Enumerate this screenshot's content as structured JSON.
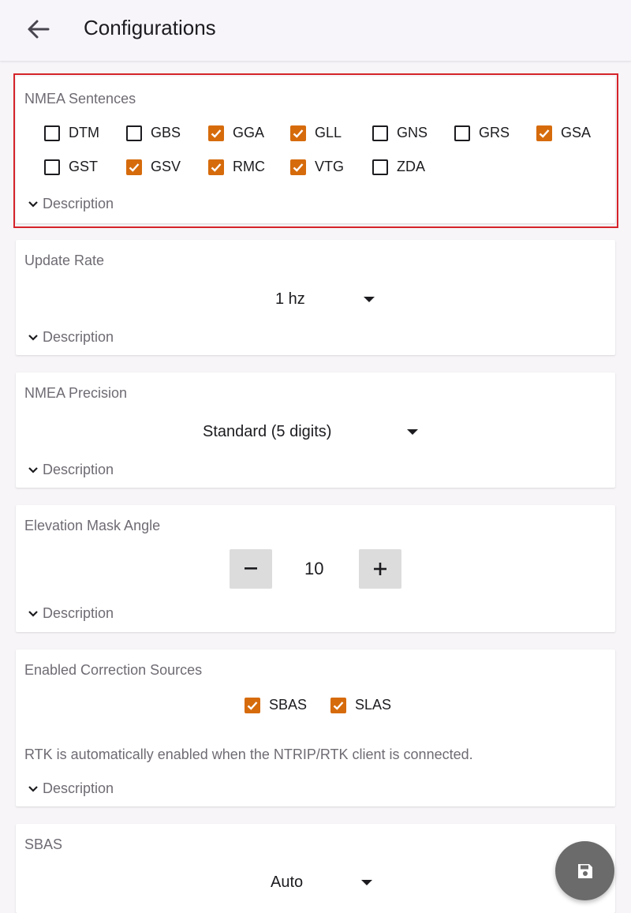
{
  "appbar": {
    "title": "Configurations"
  },
  "colors": {
    "accent": "#d66b0c",
    "highlight_border": "#d6232a",
    "fab": "#6b6b6b"
  },
  "nmea_sentences": {
    "title": "NMEA Sentences",
    "items": [
      {
        "label": "DTM",
        "checked": false
      },
      {
        "label": "GBS",
        "checked": false
      },
      {
        "label": "GGA",
        "checked": true
      },
      {
        "label": "GLL",
        "checked": true
      },
      {
        "label": "GNS",
        "checked": false
      },
      {
        "label": "GRS",
        "checked": false
      },
      {
        "label": "GSA",
        "checked": true
      },
      {
        "label": "GST",
        "checked": false
      },
      {
        "label": "GSV",
        "checked": true
      },
      {
        "label": "RMC",
        "checked": true
      },
      {
        "label": "VTG",
        "checked": true
      },
      {
        "label": "ZDA",
        "checked": false
      }
    ],
    "description": "Description"
  },
  "update_rate": {
    "title": "Update Rate",
    "value": "1 hz",
    "description": "Description"
  },
  "nmea_precision": {
    "title": "NMEA Precision",
    "value": "Standard (5 digits)",
    "description": "Description"
  },
  "elevation_mask": {
    "title": "Elevation Mask Angle",
    "value": "10",
    "minus": "−",
    "plus": "+",
    "description": "Description"
  },
  "correction_sources": {
    "title": "Enabled Correction Sources",
    "items": [
      {
        "label": "SBAS",
        "checked": true
      },
      {
        "label": "SLAS",
        "checked": true
      }
    ],
    "note": "RTK is automatically enabled when the NTRIP/RTK client is connected.",
    "description": "Description"
  },
  "sbas": {
    "title": "SBAS",
    "value": "Auto"
  },
  "fab": {
    "icon": "save-icon"
  }
}
